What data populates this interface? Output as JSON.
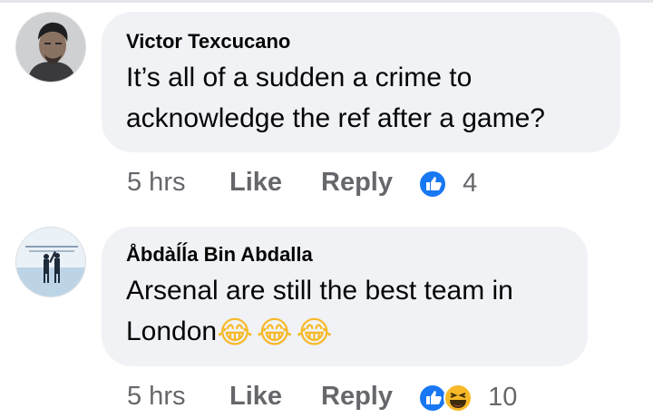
{
  "comments": [
    {
      "author": "Victor Texcucano",
      "text_line1": "It’s all of a sudden a crime to",
      "text_line2": "acknowledge the ref after a game?",
      "time": "5 hrs",
      "like_label": "Like",
      "reply_label": "Reply",
      "reaction_icons": [
        "like-reaction-icon"
      ],
      "reaction_count": "4"
    },
    {
      "author": "Åbdàĺĺa Bin Abdalla",
      "text_line1": "Arsenal are still the best team in",
      "text_line2": "London",
      "emojis": [
        "😂",
        "😂",
        "😂"
      ],
      "time": "5 hrs",
      "like_label": "Like",
      "reply_label": "Reply",
      "reaction_icons": [
        "like-reaction-icon",
        "haha-reaction-icon"
      ],
      "reaction_count": "10"
    }
  ],
  "colors": {
    "bubble": "#f0f2f5",
    "meta_text": "#65676b",
    "like_blue": "#1877f2",
    "haha_yellow": "#f7b928"
  }
}
